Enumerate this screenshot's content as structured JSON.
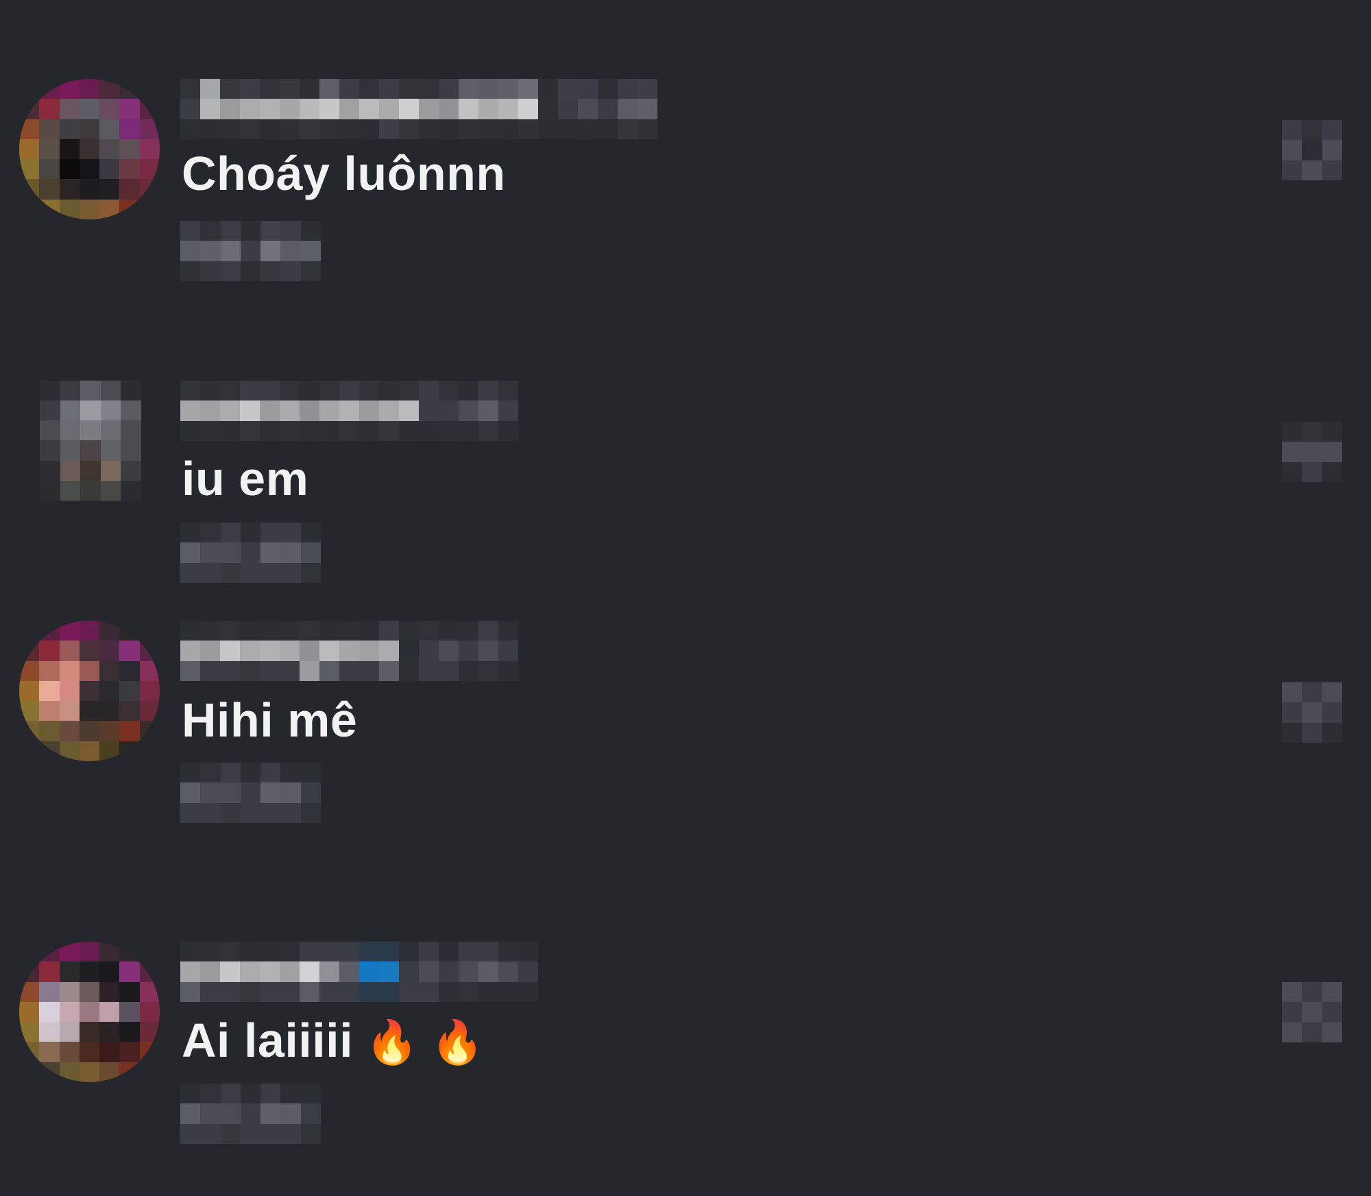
{
  "comments": [
    {
      "username": "",
      "text": "Choáy luônnn",
      "emoji": ""
    },
    {
      "username": "",
      "text": "iu em",
      "emoji": ""
    },
    {
      "username": "",
      "text": "Hihi mê",
      "emoji": ""
    },
    {
      "username": "",
      "text": "Ai laiiiii",
      "emoji": "🔥 🔥"
    }
  ],
  "icons": {
    "like": "heart-icon"
  },
  "colors": {
    "background": "#25272c",
    "text": "#f2f2f2",
    "pixel_dim": "#3a3d44",
    "pixel_mid": "#5e636b",
    "pixel_light": "#a7a9ad",
    "verified_blue": "#1478c4"
  }
}
